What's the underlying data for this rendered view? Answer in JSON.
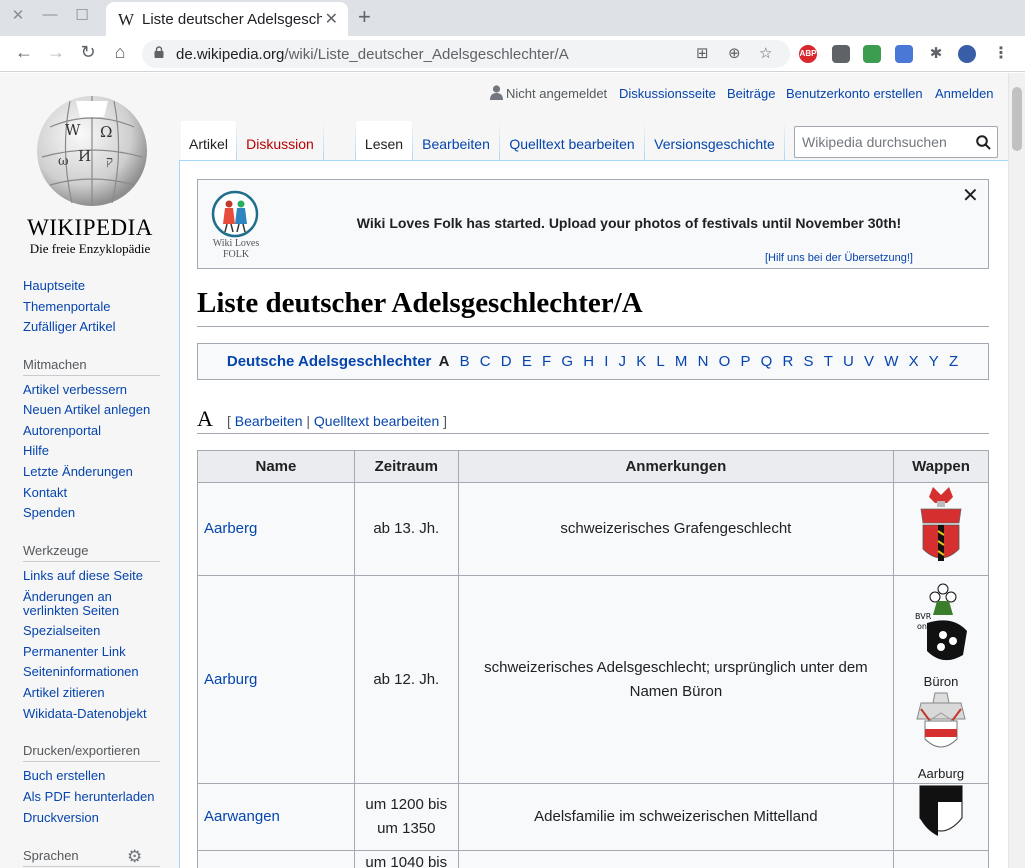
{
  "browser": {
    "tab_title": "Liste deutscher Adelsgeschlechter/A",
    "url_host": "de.wikipedia.org",
    "url_path": "/wiki/Liste_deutscher_Adelsgeschlechter/A",
    "tab_favicon": "W",
    "extensions": [
      "ABP"
    ]
  },
  "logo": {
    "wordmark": "WIKIPEDIA",
    "tagline": "Die freie Enzyklopädie"
  },
  "sidebar": {
    "main": [
      "Hauptseite",
      "Themenportale",
      "Zufälliger Artikel"
    ],
    "mitmachen_heading": "Mitmachen",
    "mitmachen": [
      "Artikel verbessern",
      "Neuen Artikel anlegen",
      "Autorenportal",
      "Hilfe",
      "Letzte Änderungen",
      "Kontakt",
      "Spenden"
    ],
    "werkzeuge_heading": "Werkzeuge",
    "werkzeuge": [
      "Links auf diese Seite",
      "Änderungen an",
      "verlinkten Seiten",
      "Spezialseiten",
      "Permanenter Link",
      "Seiteninformationen",
      "Artikel zitieren",
      "Wikidata-Datenobjekt"
    ],
    "drucken_heading": "Drucken/exportieren",
    "drucken": [
      "Buch erstellen",
      "Als PDF herunterladen",
      "Druckversion"
    ],
    "sprachen_heading": "Sprachen"
  },
  "user_bar": {
    "not_logged_in": "Nicht angemeldet",
    "discussion": "Diskussionsseite",
    "contributions": "Beiträge",
    "create_account": "Benutzerkonto erstellen",
    "login": "Anmelden"
  },
  "tabs": {
    "article": "Artikel",
    "discussion": "Diskussion",
    "read": "Lesen",
    "edit": "Bearbeiten",
    "edit_source": "Quelltext bearbeiten",
    "history": "Versionsgeschichte"
  },
  "search": {
    "placeholder": "Wikipedia durchsuchen"
  },
  "banner": {
    "text": "Wiki Loves Folk has started. Upload your photos of festivals until November 30th!",
    "help": "[Hilf uns bei der Übersetzung!]",
    "logo_line1": "Wiki Loves",
    "logo_line2": "FOLK"
  },
  "page_title": "Liste deutscher Adelsgeschlechter/A",
  "letter_nav": {
    "lead": "Deutsche Adelsgeschlechter",
    "current": "A",
    "letters": [
      "B",
      "C",
      "D",
      "E",
      "F",
      "G",
      "H",
      "I",
      "J",
      "K",
      "L",
      "M",
      "N",
      "O",
      "P",
      "Q",
      "R",
      "S",
      "T",
      "U",
      "V",
      "W",
      "X",
      "Y",
      "Z"
    ]
  },
  "section": {
    "title": "A",
    "edit": "Bearbeiten",
    "edit_source": "Quelltext bearbeiten",
    "open_bracket": "[",
    "separator": "|",
    "close_bracket": "]"
  },
  "table": {
    "headers": [
      "Name",
      "Zeitraum",
      "Anmerkungen",
      "Wappen"
    ],
    "rows": [
      {
        "name": "Aarberg",
        "period": "ab 13. Jh.",
        "note": "schweizerisches Grafengeschlecht"
      },
      {
        "name": "Aarburg",
        "period": "ab 12. Jh.",
        "note": "schweizerisches Adelsgeschlecht; ursprünglich unter dem Namen Büron",
        "crest_caption_1": "Büron",
        "crest_caption_2": "Aarburg"
      },
      {
        "name": "Aarwangen",
        "period": "um 1200 bis um 1350",
        "note": "Adelsfamilie im schweizerischen Mittelland"
      },
      {
        "name": "",
        "period": "um 1040 bis",
        "note": ""
      }
    ]
  }
}
